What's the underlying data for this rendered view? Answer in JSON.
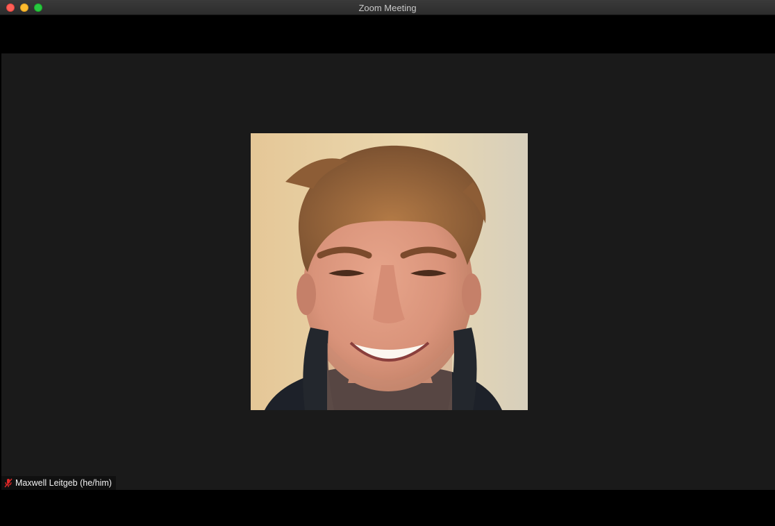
{
  "window": {
    "title": "Zoom Meeting"
  },
  "participant": {
    "name": "Maxwell Leitgeb (he/him)",
    "audio_status_icon": "muted-mic-icon"
  },
  "colors": {
    "stage_background": "#1a1a1a",
    "muted_icon": "#e02828",
    "close_button": "#fe5f57",
    "minimize_button": "#febc2e",
    "zoom_button": "#28c840"
  }
}
